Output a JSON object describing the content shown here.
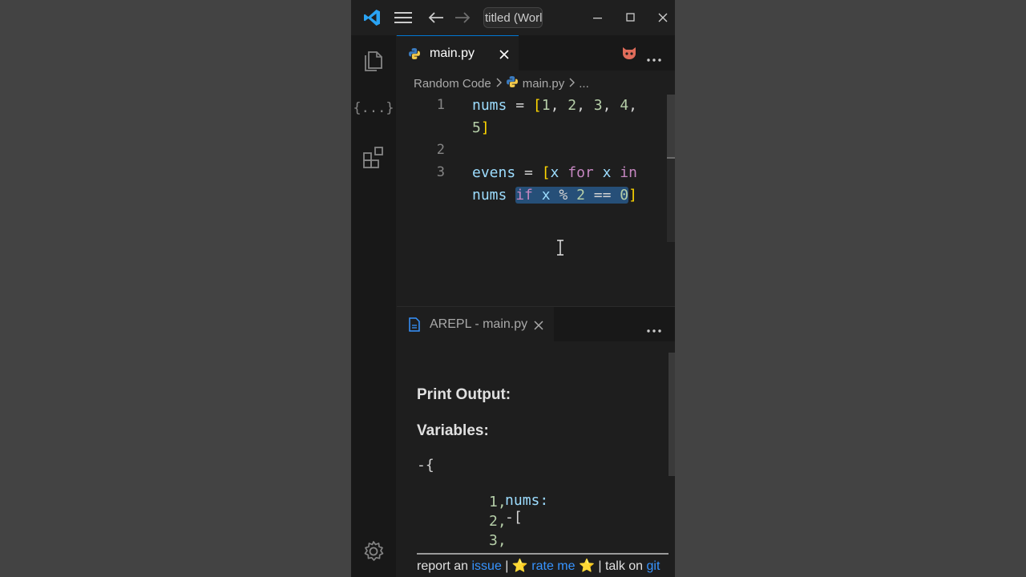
{
  "titlebar": {
    "title": "titled (Worl"
  },
  "colors": {
    "vscode_blue": "#0078d4",
    "link": "#3794ff",
    "selection": "#264f78"
  },
  "editor": {
    "active_tab": "main.py",
    "breadcrumb": {
      "folder": "Random Code",
      "file": "main.py",
      "more": "..."
    },
    "lines": [
      {
        "num": "1",
        "text": "nums = [1, 2, 3, 4, 5]"
      },
      {
        "num": "2",
        "text": ""
      },
      {
        "num": "3",
        "text": "evens = [x for x in nums if x % 2 == 0]"
      }
    ]
  },
  "panel": {
    "tab_label": "AREPL - main.py",
    "print_output_heading": "Print Output:",
    "variables_heading": "Variables:",
    "variables": {
      "open_brace": "-{",
      "nums_key": "nums:",
      "nums_open": "-[",
      "values": [
        "1,",
        "2,",
        "3,"
      ]
    },
    "footer": {
      "prefix": "report an ",
      "issue_link": "issue",
      "sep1": " | ",
      "star1": "⭐",
      "rate_link": "rate me",
      "star2": "⭐",
      "sep2": " | talk on ",
      "git_link": "git"
    }
  }
}
